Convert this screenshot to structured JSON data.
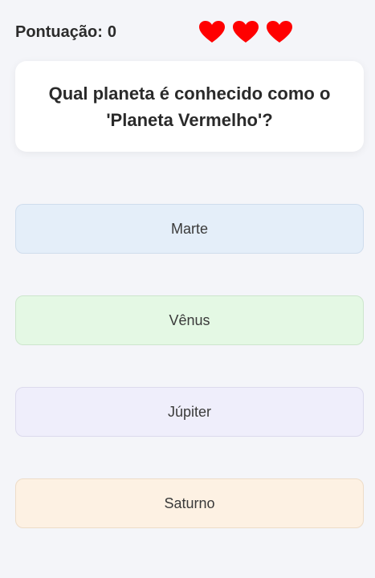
{
  "header": {
    "score_label": "Pontuação:",
    "score_value": "0",
    "lives": 3,
    "heart_color": "#ff0000",
    "heart_icon": "heart-icon"
  },
  "question": {
    "text": "Qual planeta é conhecido como o 'Planeta Vermelho'?"
  },
  "options": [
    {
      "label": "Marte",
      "color": "#e4eef9"
    },
    {
      "label": "Vênus",
      "color": "#e4f8e4"
    },
    {
      "label": "Júpiter",
      "color": "#efeefb"
    },
    {
      "label": "Saturno",
      "color": "#fdf1e3"
    }
  ]
}
